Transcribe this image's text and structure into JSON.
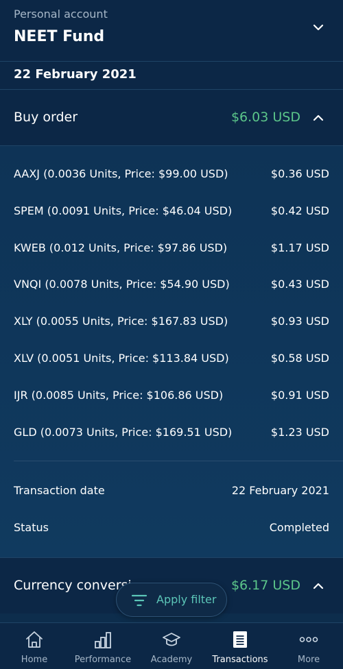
{
  "header": {
    "subtitle": "Personal account",
    "title": "NEET Fund",
    "toggle_icon": "chevron-down-icon"
  },
  "date_heading": "22 February 2021",
  "buy_order": {
    "label": "Buy order",
    "amount": "$6.03 USD",
    "toggle_icon": "chevron-up-icon",
    "holdings": [
      {
        "desc": "AAXJ (0.0036 Units, Price: $99.00 USD)",
        "value": "$0.36 USD"
      },
      {
        "desc": "SPEM (0.0091 Units, Price: $46.04 USD)",
        "value": "$0.42 USD"
      },
      {
        "desc": "KWEB (0.012 Units, Price: $97.86 USD)",
        "value": "$1.17 USD"
      },
      {
        "desc": "VNQI (0.0078 Units, Price: $54.90 USD)",
        "value": "$0.43 USD"
      },
      {
        "desc": "XLY (0.0055 Units, Price: $167.83 USD)",
        "value": "$0.93 USD"
      },
      {
        "desc": "XLV (0.0051 Units, Price: $113.84 USD)",
        "value": "$0.58 USD"
      },
      {
        "desc": "IJR (0.0085 Units, Price: $106.86 USD)",
        "value": "$0.91 USD"
      },
      {
        "desc": "GLD (0.0073 Units, Price: $169.51 USD)",
        "value": "$1.23 USD"
      }
    ],
    "details": [
      {
        "label": "Transaction date",
        "value": "22 February 2021"
      },
      {
        "label": "Status",
        "value": "Completed"
      }
    ]
  },
  "currency_conversion": {
    "label": "Currency conversi",
    "amount": "$6.17 USD",
    "toggle_icon": "chevron-up-icon"
  },
  "filter": {
    "label": "Apply filter",
    "icon": "filter-icon"
  },
  "tabs": [
    {
      "label": "Home",
      "icon": "home-icon",
      "active": false
    },
    {
      "label": "Performance",
      "icon": "bar-chart-icon",
      "active": false
    },
    {
      "label": "Academy",
      "icon": "graduation-cap-icon",
      "active": false
    },
    {
      "label": "Transactions",
      "icon": "document-icon",
      "active": true
    },
    {
      "label": "More",
      "icon": "more-icon",
      "active": false
    }
  ],
  "colors": {
    "background": "#0d2d4c",
    "positive": "#5cc68a",
    "accent": "#5cc6b8",
    "muted_text": "#a6b7c8"
  }
}
